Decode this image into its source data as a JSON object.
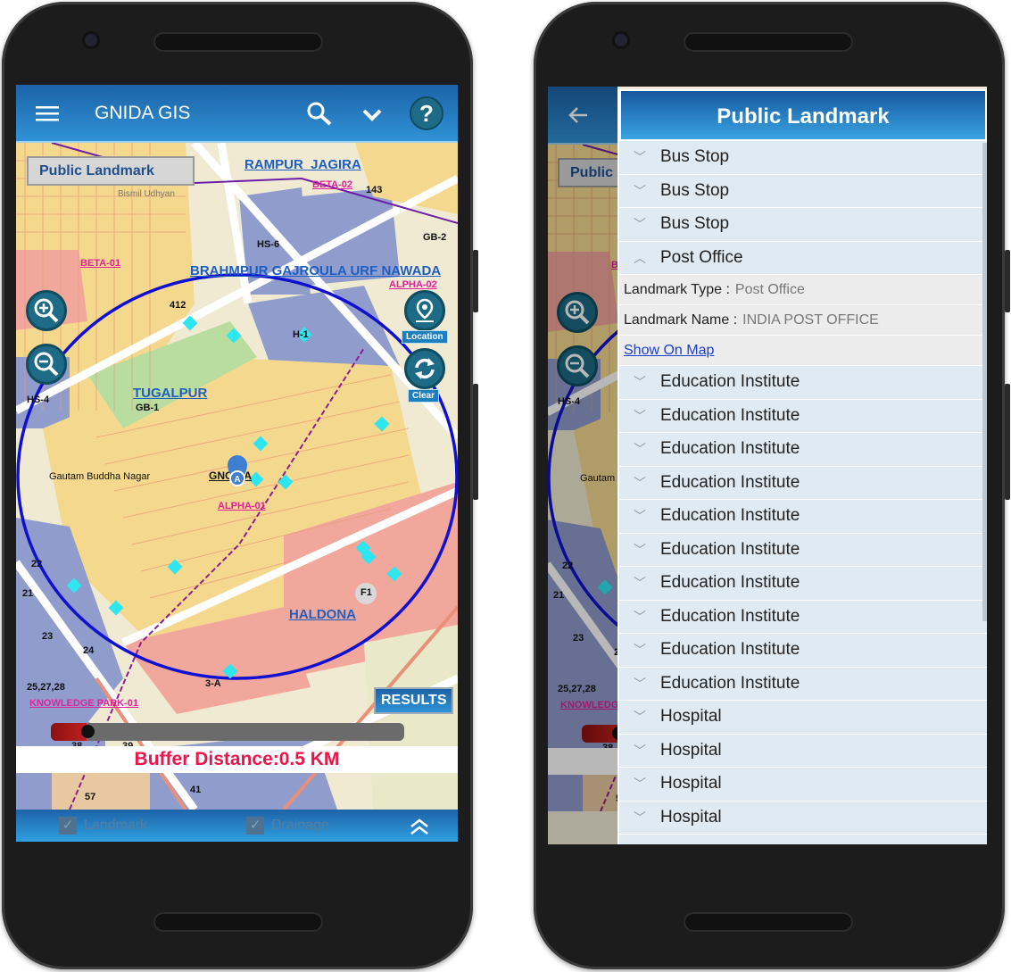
{
  "app": {
    "title": "GNIDA GIS"
  },
  "map": {
    "layer_label": "Public Landmark",
    "localities": [
      "RAMPUR_JAGIRA",
      "BRAHMPUR GAJROULA URF NAWADA",
      "TUGALPUR",
      "HALDONA"
    ],
    "sectors": [
      "BETA-02",
      "BETA-01",
      "ALPHA-02",
      "ALPHA-01",
      "KNOWLEDGE PARK-01"
    ],
    "plots": [
      "143",
      "HS-6",
      "GB-2",
      "412",
      "H-1",
      "GB-1",
      "HS-4",
      "F1",
      "22",
      "21",
      "23",
      "24",
      "25,27,28",
      "3-A",
      "38",
      "39",
      "57",
      "41"
    ],
    "places": [
      "Bismil Udhyan",
      "Gautam Buddha Nagar",
      "GNOIDA"
    ],
    "location_label": "Location",
    "clear_label": "Clear",
    "results_label": "RESULTS",
    "buffer_text": "Buffer Distance:0.5 KM",
    "buffer_km": 0.5,
    "slider_fraction": 0.1
  },
  "bottom_bar": {
    "items": [
      {
        "label": "Landmark",
        "checked": true
      },
      {
        "label": "Drainage",
        "checked": true
      }
    ]
  },
  "panel": {
    "title": "Public Landmark",
    "items": [
      {
        "label": "Bus Stop"
      },
      {
        "label": "Bus Stop"
      },
      {
        "label": "Bus Stop"
      },
      {
        "label": "Post Office",
        "expanded": true
      }
    ],
    "detail": {
      "type_label": "Landmark Type :",
      "type_value": "Post Office",
      "name_label": "Landmark Name :",
      "name_value": "INDIA POST OFFICE",
      "link": "Show On Map"
    },
    "more_items": [
      "Education Institute",
      "Education Institute",
      "Education Institute",
      "Education Institute",
      "Education Institute",
      "Education Institute",
      "Education Institute",
      "Education Institute",
      "Education Institute",
      "Education Institute",
      "Hospital",
      "Hospital",
      "Hospital",
      "Hospital"
    ]
  },
  "colors": {
    "header": "#1d63a8",
    "buffer_text": "#e8164a",
    "buffer_circle": "#1010d0",
    "landmark_marker": "#2ee6f0"
  }
}
